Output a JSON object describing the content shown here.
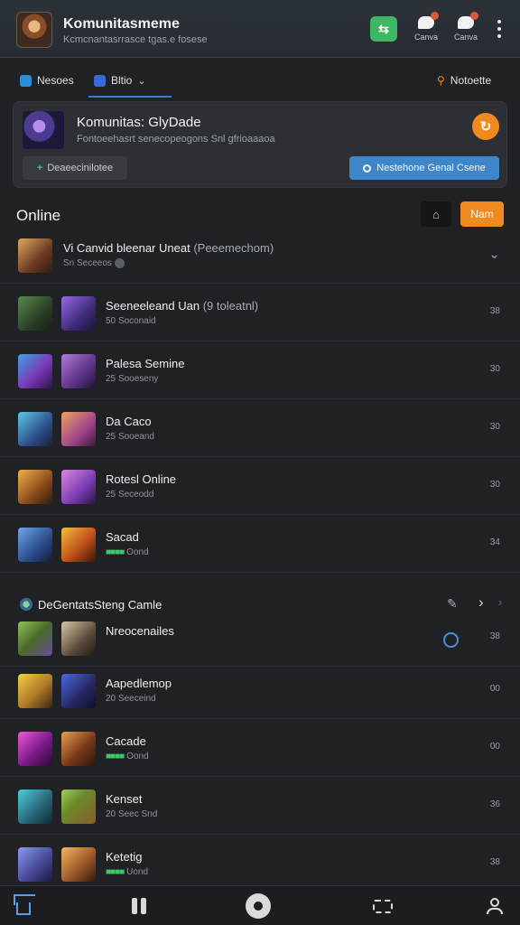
{
  "header": {
    "title": "Komunitasmeme",
    "subtitle": "Kcmcnantasrrasce tgas.e fosese",
    "action1_label": "Canva",
    "action2_label": "Canva"
  },
  "filter_bar": {
    "chip1": "Nesoes",
    "chip2": "Bltio",
    "chip3": "Notoette"
  },
  "community_card": {
    "title": "Komunitas: GlyDade",
    "description": "Fontoeehasrt senecopeogons Snl gfrioaaaoa",
    "left_button": "Deaeecinilotee",
    "primary_button": "Nestehone Genal Csene"
  },
  "online_section": {
    "title": "Online",
    "new_button": "Nam"
  },
  "online_rows": [
    {
      "name": "Vi Canvid bleenar Uneat",
      "extra": "(Peeemechom)",
      "status": "Sn Seceeos",
      "count": ""
    },
    {
      "name": "Seeneeleand Uan",
      "extra": "(9 toleatnl)",
      "status": "50 Soconaid",
      "count": "38"
    },
    {
      "name": "Palesa Semine",
      "extra": "",
      "status": "25 Sooeseny",
      "count": "30"
    },
    {
      "name": "Da Caco",
      "extra": "",
      "status": "25 Sooeand",
      "count": "30"
    },
    {
      "name": "Rotesl Online",
      "extra": "",
      "status": "25 Seceodd",
      "count": "30"
    },
    {
      "name": "Sacad",
      "extra": "",
      "status": "Oond",
      "count": "34"
    }
  ],
  "group_section": {
    "title": "DeGentatsSteng Camle"
  },
  "group_rows": [
    {
      "name": "Nreocenailes",
      "status": "",
      "count": "38"
    },
    {
      "name": "Aapedlemop",
      "status": "20 Seeceind",
      "count": "00"
    },
    {
      "name": "Cacade",
      "status": "Oond",
      "count": "00"
    },
    {
      "name": "Kenset",
      "status": "20 Seec Snd",
      "count": "36"
    },
    {
      "name": "Ketetig",
      "status": "Uond",
      "count": "38"
    }
  ]
}
